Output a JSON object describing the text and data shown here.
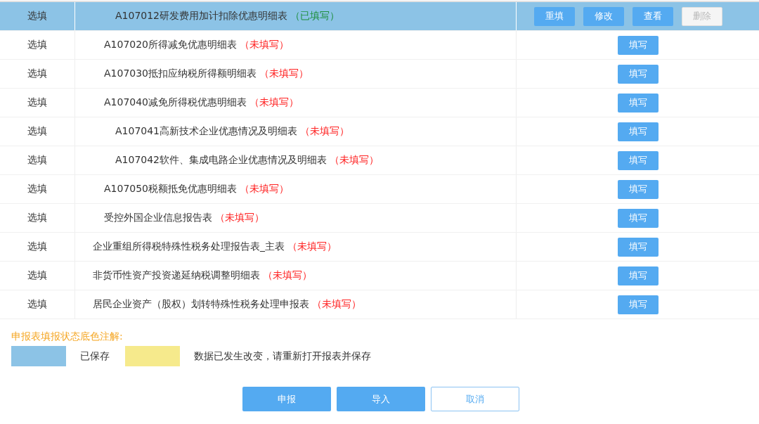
{
  "rows": [
    {
      "children": [
        {
          "children": [
            {
              "requirement": "选填",
              "title": "A107012研发费用加计扣除优惠明细表",
              "status": "（已填写）",
              "filled": true,
              "saved": true,
              "actions": [
                {
                  "label": "重填",
                  "disabled": false
                },
                {
                  "label": "修改",
                  "disabled": false
                },
                {
                  "label": "查看",
                  "disabled": false
                },
                {
                  "label": "删除",
                  "disabled": true
                }
              ]
            }
          ]
        },
        {
          "requirement": "选填",
          "title": "A107020所得减免优惠明细表",
          "status": "（未填写）",
          "filled": false,
          "saved": false,
          "actions": [
            {
              "label": "填写",
              "disabled": false
            }
          ]
        },
        {
          "requirement": "选填",
          "title": "A107030抵扣应纳税所得额明细表",
          "status": "（未填写）",
          "filled": false,
          "saved": false,
          "actions": [
            {
              "label": "填写",
              "disabled": false
            }
          ]
        },
        {
          "requirement": "选填",
          "title": "A107040减免所得税优惠明细表",
          "status": "（未填写）",
          "filled": false,
          "saved": false,
          "actions": [
            {
              "label": "填写",
              "disabled": false
            }
          ],
          "children": [
            {
              "requirement": "选填",
              "title": "A107041高新技术企业优惠情况及明细表",
              "status": "（未填写）",
              "filled": false,
              "saved": false,
              "actions": [
                {
                  "label": "填写",
                  "disabled": false
                }
              ]
            },
            {
              "requirement": "选填",
              "title": "A107042软件、集成电路企业优惠情况及明细表",
              "status": "（未填写）",
              "filled": false,
              "saved": false,
              "actions": [
                {
                  "label": "填写",
                  "disabled": false
                }
              ]
            }
          ]
        },
        {
          "requirement": "选填",
          "title": "A107050税额抵免优惠明细表",
          "status": "（未填写）",
          "filled": false,
          "saved": false,
          "actions": [
            {
              "label": "填写",
              "disabled": false
            }
          ]
        },
        {
          "requirement": "选填",
          "title": "受控外国企业信息报告表",
          "status": "（未填写）",
          "filled": false,
          "saved": false,
          "actions": [
            {
              "label": "填写",
              "disabled": false
            }
          ]
        }
      ]
    },
    {
      "requirement": "选填",
      "title": "企业重组所得税特殊性税务处理报告表_主表",
      "status": "（未填写）",
      "filled": false,
      "saved": false,
      "actions": [
        {
          "label": "填写",
          "disabled": false
        }
      ]
    },
    {
      "requirement": "选填",
      "title": "非货币性资产投资递延纳税调整明细表",
      "status": "（未填写）",
      "filled": false,
      "saved": false,
      "actions": [
        {
          "label": "填写",
          "disabled": false
        }
      ]
    },
    {
      "requirement": "选填",
      "title": "居民企业资产（股权）划转特殊性税务处理申报表",
      "status": "（未填写）",
      "filled": false,
      "saved": false,
      "actions": [
        {
          "label": "填写",
          "disabled": false
        }
      ]
    }
  ],
  "legend": {
    "title": "申报表填报状态底色注解:",
    "items": [
      {
        "color": "#8cc3e6",
        "label": "已保存"
      },
      {
        "color": "#f6ea8c",
        "label": "数据已发生改变，请重新打开报表并保存"
      }
    ]
  },
  "buttons": [
    {
      "label": "申报",
      "kind": "primary"
    },
    {
      "label": "导入",
      "kind": "primary"
    },
    {
      "label": "取消",
      "kind": "secondary"
    }
  ]
}
